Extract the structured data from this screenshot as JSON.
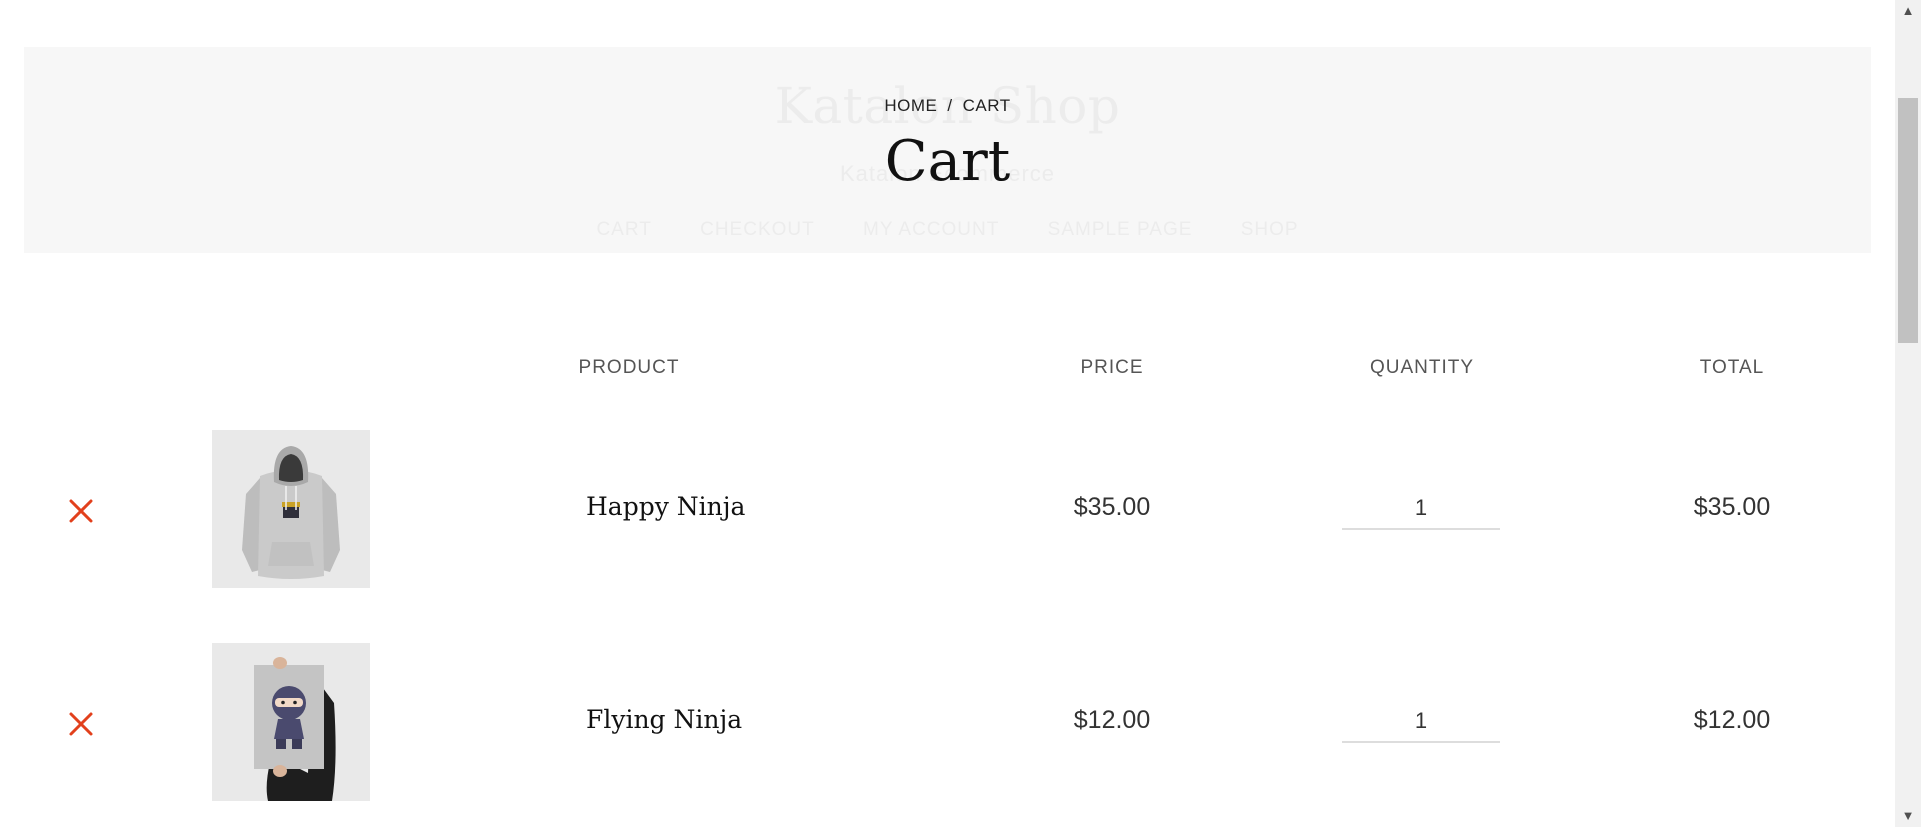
{
  "header": {
    "site_title": "Katalon Shop",
    "tagline": "Katalon Ecommerce",
    "nav": [
      "CART",
      "CHECKOUT",
      "MY ACCOUNT",
      "SAMPLE PAGE",
      "SHOP"
    ],
    "breadcrumb": {
      "home": "HOME",
      "separator": "/",
      "current": "CART"
    },
    "page_title": "Cart"
  },
  "table": {
    "columns": {
      "product": "PRODUCT",
      "price": "PRICE",
      "quantity": "QUANTITY",
      "total": "TOTAL"
    },
    "rows": [
      {
        "name": "Happy Ninja",
        "price": "$35.00",
        "quantity": "1",
        "total": "$35.00",
        "image": "hoodie-image"
      },
      {
        "name": "Flying Ninja",
        "price": "$12.00",
        "quantity": "1",
        "total": "$12.00",
        "image": "poster-image"
      }
    ]
  },
  "colors": {
    "remove_icon": "#e2401c",
    "header_band": "#f7f7f7"
  },
  "icons": {
    "remove": "close-icon",
    "scroll_up": "arrow-up-icon",
    "scroll_down": "arrow-down-icon"
  }
}
